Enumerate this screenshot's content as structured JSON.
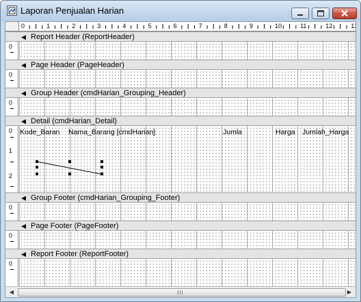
{
  "window": {
    "title": "Laporan Penjualan Harian",
    "controls": {
      "minimize": "minimize-icon",
      "maximize": "maximize-icon",
      "close": "close-icon"
    }
  },
  "ruler": {
    "horizontal_labels": [
      "0",
      "1",
      "2",
      "3",
      "4",
      "5",
      "6",
      "7",
      "8",
      "9",
      "10",
      "11",
      "12",
      "13"
    ],
    "vertical_labels": [
      "0",
      "1",
      "2"
    ]
  },
  "sections": [
    {
      "label": "Report Header (ReportHeader)"
    },
    {
      "label": "Page Header (PageHeader)"
    },
    {
      "label": "Group Header (cmdHarian_Grouping_Header)"
    },
    {
      "label": "Detail (cmdHarian_Detail)"
    },
    {
      "label": "Group Footer (cmdHarian_Grouping_Footer)"
    },
    {
      "label": "Page Footer (PageFooter)"
    },
    {
      "label": "Report Footer (ReportFooter)"
    }
  ],
  "detail_fields": [
    {
      "text": "Kode_Baran"
    },
    {
      "text": "Nama_Barang [cmdHarian]"
    },
    {
      "text": "Jumla"
    },
    {
      "text": "Harga"
    },
    {
      "text": "Jumlah_Harga"
    }
  ],
  "scrollbar": {
    "grip": "III"
  },
  "colors": {
    "band_header": "#e4e4e4",
    "window_frame": "#c9dced",
    "close_button": "#c9533f"
  }
}
